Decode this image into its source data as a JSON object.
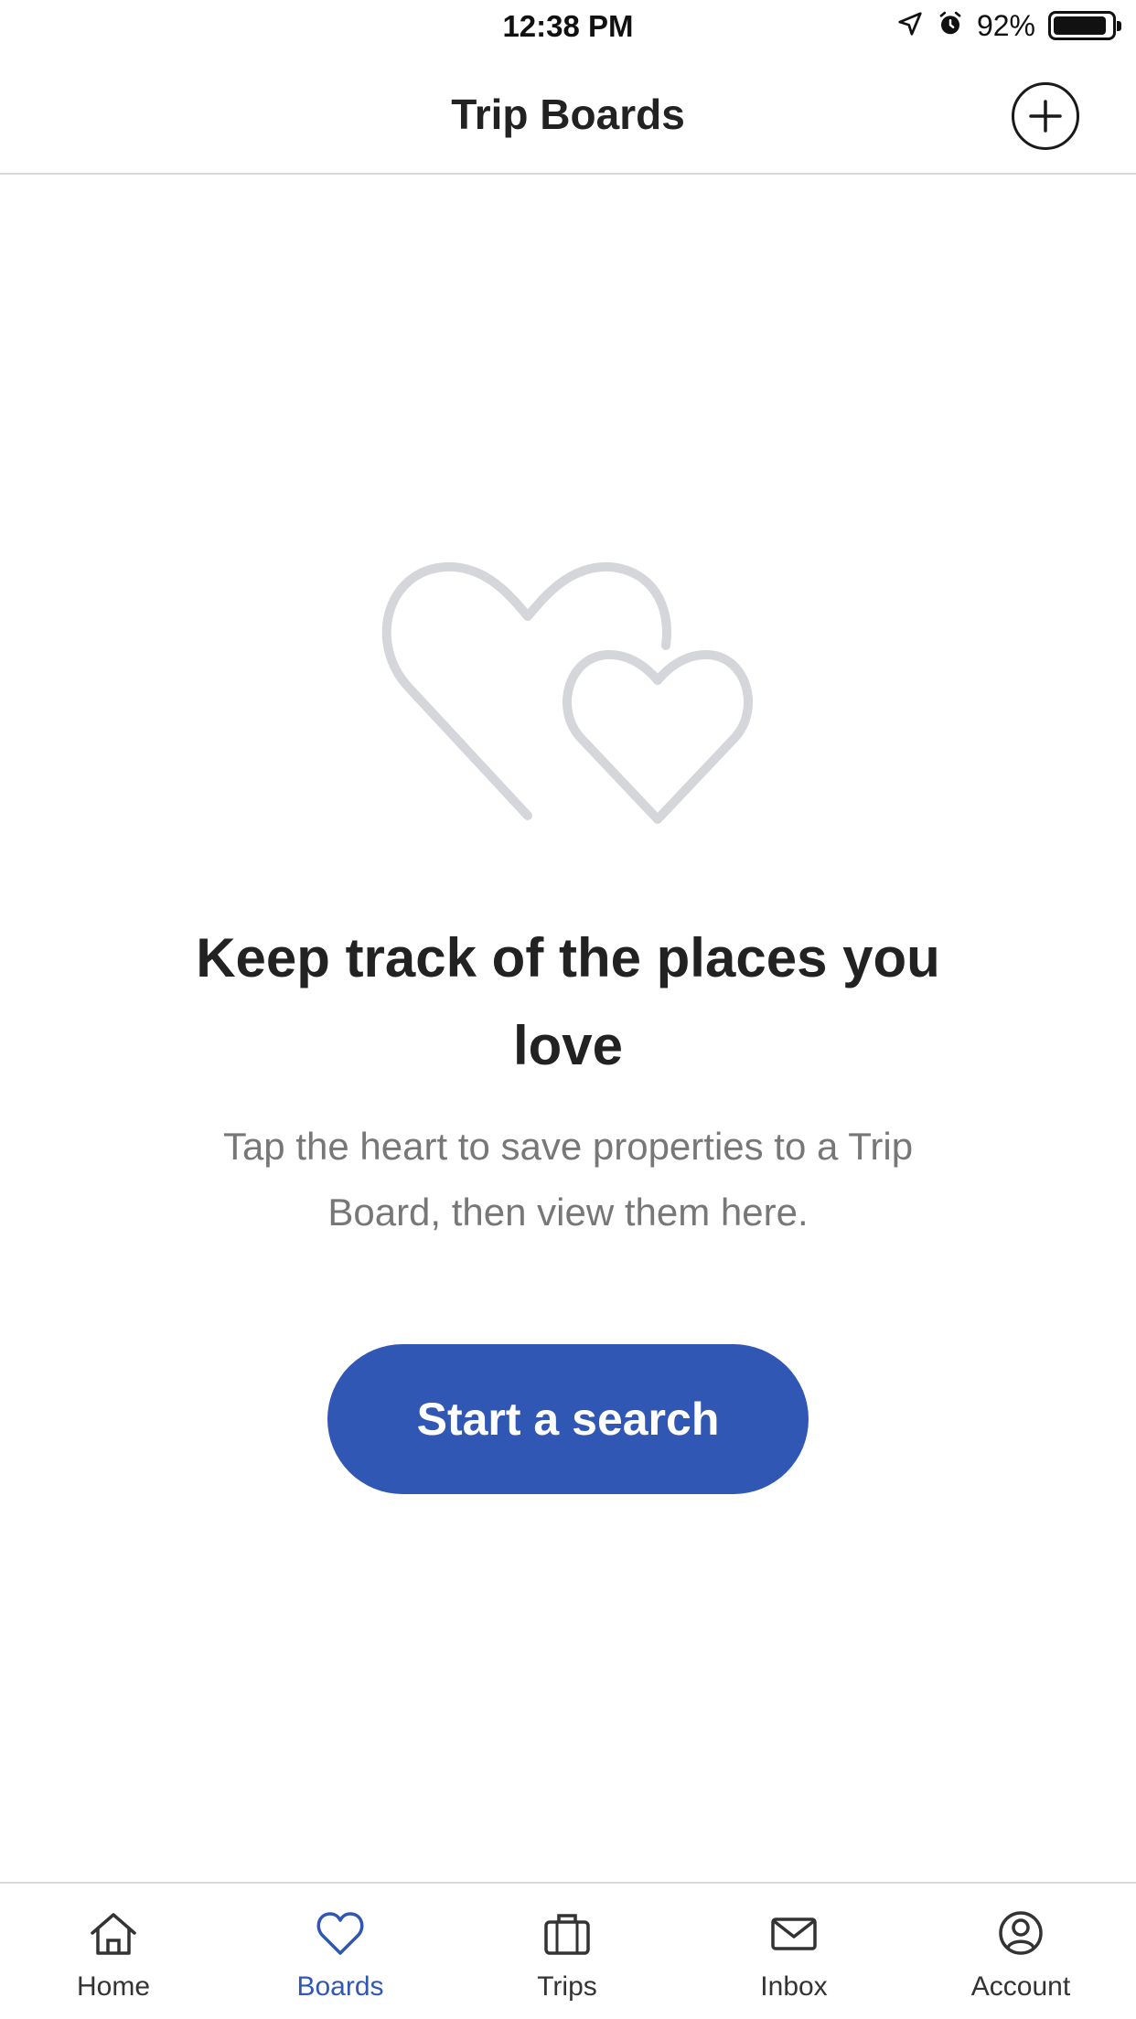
{
  "status_bar": {
    "time": "12:38 PM",
    "battery": "92%",
    "battery_level": 0.92
  },
  "header": {
    "title": "Trip Boards",
    "add_icon": "plus-circle-icon"
  },
  "empty_state": {
    "illustration": "two-hearts-icon",
    "title": "Keep track of the places you love",
    "description": "Tap the heart to save properties to a Trip Board, then view them here.",
    "cta_label": "Start a search"
  },
  "tab_bar": {
    "active": "boards",
    "items": [
      {
        "id": "home",
        "label": "Home",
        "icon": "home-icon"
      },
      {
        "id": "boards",
        "label": "Boards",
        "icon": "heart-icon"
      },
      {
        "id": "trips",
        "label": "Trips",
        "icon": "suitcase-icon"
      },
      {
        "id": "inbox",
        "label": "Inbox",
        "icon": "envelope-icon"
      },
      {
        "id": "account",
        "label": "Account",
        "icon": "person-icon"
      }
    ]
  },
  "colors": {
    "accent": "#3157b5",
    "text_primary": "#222222",
    "text_secondary": "#777777",
    "divider": "#d9d9d9",
    "illustration": "#d4d6da"
  }
}
